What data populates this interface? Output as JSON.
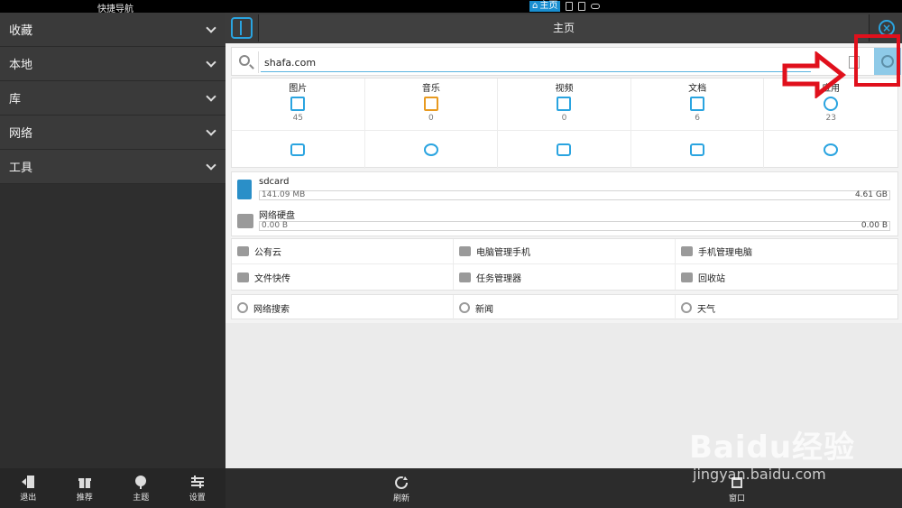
{
  "status_bar": {
    "nav_title": "快捷导航",
    "active_tab": "主页"
  },
  "sidebar": {
    "items": [
      {
        "label": "收藏"
      },
      {
        "label": "本地"
      },
      {
        "label": "库"
      },
      {
        "label": "网络"
      },
      {
        "label": "工具"
      }
    ]
  },
  "bottom_left": {
    "buttons": [
      {
        "label": "退出",
        "icon": "exit-icon"
      },
      {
        "label": "推荐",
        "icon": "gift-icon"
      },
      {
        "label": "主题",
        "icon": "theme-icon"
      },
      {
        "label": "设置",
        "icon": "settings-icon"
      }
    ]
  },
  "bottom_right": {
    "refresh_label": "刷新",
    "window_label": "窗口"
  },
  "header": {
    "title": "主页"
  },
  "search": {
    "value": "shafa.com"
  },
  "categories": [
    {
      "label": "图片",
      "count": "45",
      "icon": "image-icon"
    },
    {
      "label": "音乐",
      "count": "0",
      "icon": "music-icon"
    },
    {
      "label": "视频",
      "count": "0",
      "icon": "video-icon"
    },
    {
      "label": "文档",
      "count": "6",
      "icon": "document-icon"
    },
    {
      "label": "应用",
      "count": "23",
      "icon": "android-icon"
    }
  ],
  "storage": [
    {
      "name": "sdcard",
      "used": "141.09 MB",
      "total": "4.61 GB",
      "used_fraction": 0.03
    },
    {
      "name": "网络硬盘",
      "used": "0.00 B",
      "total": "0.00 B",
      "used_fraction": 0
    }
  ],
  "links": {
    "row1": [
      "公有云",
      "电脑管理手机",
      "手机管理电脑"
    ],
    "row2": [
      "文件快传",
      "任务管理器",
      "回收站"
    ],
    "row3": [
      "网络搜索",
      "新闻",
      "天气"
    ]
  },
  "watermark": {
    "brand": "Baidu经验",
    "url": "jingyan.baidu.com"
  },
  "colors": {
    "accent": "#2aa4e0",
    "highlight": "#e0101c",
    "sidebar": "#3a3a3a"
  }
}
